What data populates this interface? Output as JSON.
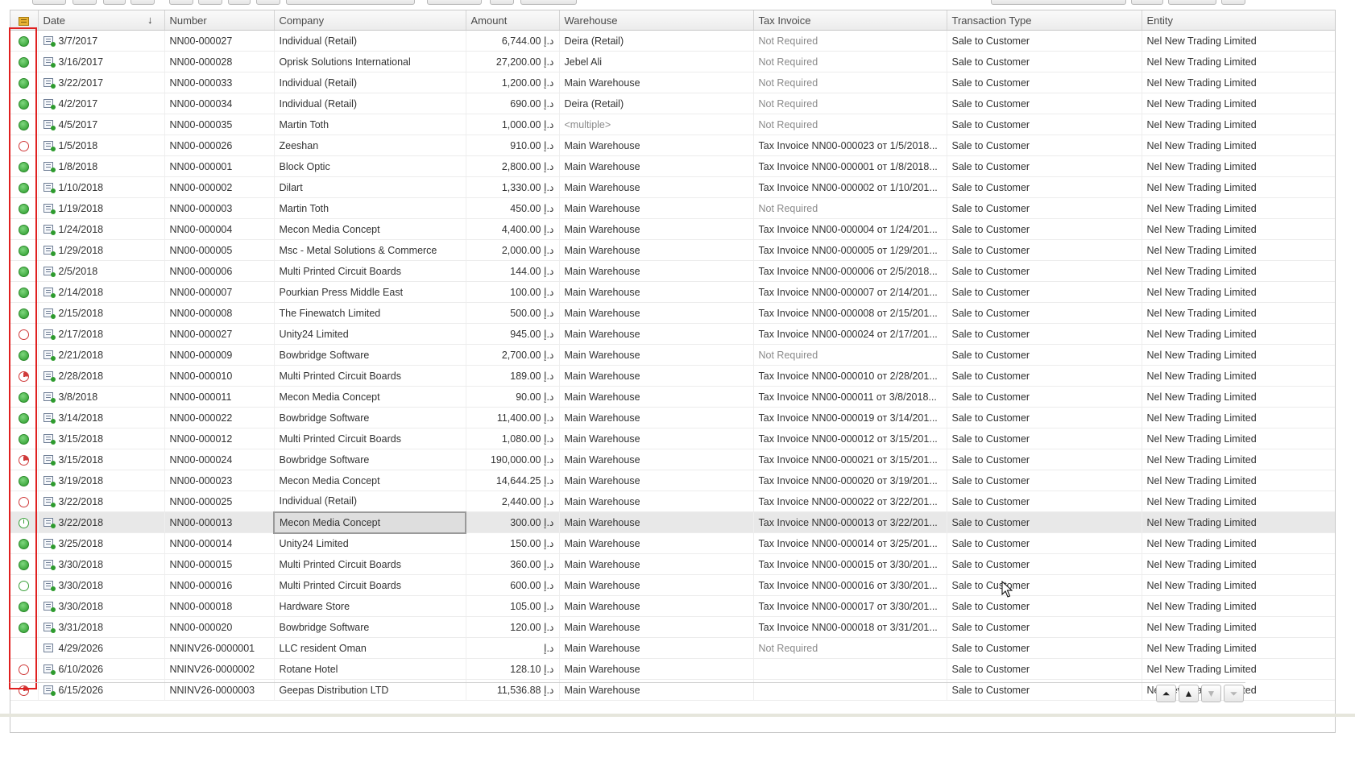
{
  "columns": {
    "date": "Date",
    "number": "Number",
    "company": "Company",
    "amount": "Amount",
    "warehouse": "Warehouse",
    "tax_invoice": "Tax Invoice",
    "transaction_type": "Transaction Type",
    "entity": "Entity"
  },
  "sort_indicator": "↓",
  "rows": [
    {
      "status": "green",
      "date": "3/7/2017",
      "number": "NN00-000027",
      "company": "Individual (Retail)",
      "amount": "6,744.00 د.إ",
      "warehouse": "Deira (Retail)",
      "tax": "Not Required",
      "tax_grey": true,
      "type": "Sale to Customer",
      "entity": "Nel New Trading Limited"
    },
    {
      "status": "green",
      "date": "3/16/2017",
      "number": "NN00-000028",
      "company": "Oprisk Solutions International",
      "amount": "27,200.00 د.إ",
      "warehouse": "Jebel Ali",
      "tax": "Not Required",
      "tax_grey": true,
      "type": "Sale to Customer",
      "entity": "Nel New Trading Limited"
    },
    {
      "status": "green",
      "date": "3/22/2017",
      "number": "NN00-000033",
      "company": "Individual (Retail)",
      "amount": "1,200.00 د.إ",
      "warehouse": "Main Warehouse",
      "tax": "Not Required",
      "tax_grey": true,
      "type": "Sale to Customer",
      "entity": "Nel New Trading Limited"
    },
    {
      "status": "green",
      "date": "4/2/2017",
      "number": "NN00-000034",
      "company": "Individual (Retail)",
      "amount": "690.00 د.إ",
      "warehouse": "Deira (Retail)",
      "tax": "Not Required",
      "tax_grey": true,
      "type": "Sale to Customer",
      "entity": "Nel New Trading Limited"
    },
    {
      "status": "green",
      "date": "4/5/2017",
      "number": "NN00-000035",
      "company": "Martin Toth",
      "amount": "1,000.00 د.إ",
      "warehouse": "<multiple>",
      "warehouse_grey": true,
      "tax": "Not Required",
      "tax_grey": true,
      "type": "Sale to Customer",
      "entity": "Nel New Trading Limited"
    },
    {
      "status": "empty-red",
      "date": "1/5/2018",
      "number": "NN00-000026",
      "company": "Zeeshan",
      "amount": "910.00 د.إ",
      "warehouse": "Main Warehouse",
      "tax": "Tax Invoice NN00-000023 от 1/5/2018...",
      "type": "Sale to Customer",
      "entity": "Nel New Trading Limited"
    },
    {
      "status": "green",
      "date": "1/8/2018",
      "number": "NN00-000001",
      "company": "Block Optic",
      "amount": "2,800.00 د.إ",
      "warehouse": "Main Warehouse",
      "tax": "Tax Invoice NN00-000001 от 1/8/2018...",
      "type": "Sale to Customer",
      "entity": "Nel New Trading Limited"
    },
    {
      "status": "green",
      "date": "1/10/2018",
      "number": "NN00-000002",
      "company": "Dilart",
      "amount": "1,330.00 د.إ",
      "warehouse": "Main Warehouse",
      "tax": "Tax Invoice NN00-000002 от 1/10/201...",
      "type": "Sale to Customer",
      "entity": "Nel New Trading Limited"
    },
    {
      "status": "green",
      "date": "1/19/2018",
      "number": "NN00-000003",
      "company": "Martin Toth",
      "amount": "450.00 د.إ",
      "warehouse": "Main Warehouse",
      "tax": "Not Required",
      "tax_grey": true,
      "type": "Sale to Customer",
      "entity": "Nel New Trading Limited"
    },
    {
      "status": "green",
      "date": "1/24/2018",
      "number": "NN00-000004",
      "company": "Mecon Media Concept",
      "amount": "4,400.00 د.إ",
      "warehouse": "Main Warehouse",
      "tax": "Tax Invoice NN00-000004 от 1/24/201...",
      "type": "Sale to Customer",
      "entity": "Nel New Trading Limited"
    },
    {
      "status": "green",
      "date": "1/29/2018",
      "number": "NN00-000005",
      "company": "Msc - Metal Solutions & Commerce",
      "amount": "2,000.00 د.إ",
      "warehouse": "Main Warehouse",
      "tax": "Tax Invoice NN00-000005 от 1/29/201...",
      "type": "Sale to Customer",
      "entity": "Nel New Trading Limited"
    },
    {
      "status": "green",
      "date": "2/5/2018",
      "number": "NN00-000006",
      "company": "Multi Printed Circuit Boards",
      "amount": "144.00 د.إ",
      "warehouse": "Main Warehouse",
      "tax": "Tax Invoice NN00-000006 от 2/5/2018...",
      "type": "Sale to Customer",
      "entity": "Nel New Trading Limited"
    },
    {
      "status": "green",
      "date": "2/14/2018",
      "number": "NN00-000007",
      "company": "Pourkian Press Middle East",
      "amount": "100.00 د.إ",
      "warehouse": "Main Warehouse",
      "tax": "Tax Invoice NN00-000007 от 2/14/201...",
      "type": "Sale to Customer",
      "entity": "Nel New Trading Limited"
    },
    {
      "status": "green",
      "date": "2/15/2018",
      "number": "NN00-000008",
      "company": "The Finewatch Limited",
      "amount": "500.00 د.إ",
      "warehouse": "Main Warehouse",
      "tax": "Tax Invoice NN00-000008 от 2/15/201...",
      "type": "Sale to Customer",
      "entity": "Nel New Trading Limited"
    },
    {
      "status": "empty-red",
      "date": "2/17/2018",
      "number": "NN00-000027",
      "company": "Unity24 Limited",
      "amount": "945.00 د.إ",
      "warehouse": "Main Warehouse",
      "tax": "Tax Invoice NN00-000024 от 2/17/201...",
      "type": "Sale to Customer",
      "entity": "Nel New Trading Limited"
    },
    {
      "status": "green",
      "date": "2/21/2018",
      "number": "NN00-000009",
      "company": "Bowbridge Software",
      "amount": "2,700.00 د.إ",
      "warehouse": "Main Warehouse",
      "tax": "Not Required",
      "tax_grey": true,
      "type": "Sale to Customer",
      "entity": "Nel New Trading Limited"
    },
    {
      "status": "partial-red",
      "date": "2/28/2018",
      "number": "NN00-000010",
      "company": "Multi Printed Circuit Boards",
      "amount": "189.00 د.إ",
      "warehouse": "Main Warehouse",
      "tax": "Tax Invoice NN00-000010 от 2/28/201...",
      "type": "Sale to Customer",
      "entity": "Nel New Trading Limited"
    },
    {
      "status": "green",
      "date": "3/8/2018",
      "number": "NN00-000011",
      "company": "Mecon Media Concept",
      "amount": "90.00 د.إ",
      "warehouse": "Main Warehouse",
      "tax": "Tax Invoice NN00-000011 от 3/8/2018...",
      "type": "Sale to Customer",
      "entity": "Nel New Trading Limited"
    },
    {
      "status": "green",
      "date": "3/14/2018",
      "number": "NN00-000022",
      "company": "Bowbridge Software",
      "amount": "11,400.00 د.إ",
      "warehouse": "Main Warehouse",
      "tax": "Tax Invoice NN00-000019 от 3/14/201...",
      "type": "Sale to Customer",
      "entity": "Nel New Trading Limited"
    },
    {
      "status": "green",
      "date": "3/15/2018",
      "number": "NN00-000012",
      "company": "Multi Printed Circuit Boards",
      "amount": "1,080.00 د.إ",
      "warehouse": "Main Warehouse",
      "tax": "Tax Invoice NN00-000012 от 3/15/201...",
      "type": "Sale to Customer",
      "entity": "Nel New Trading Limited"
    },
    {
      "status": "partial-red",
      "date": "3/15/2018",
      "number": "NN00-000024",
      "company": "Bowbridge Software",
      "amount": "190,000.00 د.إ",
      "warehouse": "Main Warehouse",
      "tax": "Tax Invoice NN00-000021 от 3/15/201...",
      "type": "Sale to Customer",
      "entity": "Nel New Trading Limited"
    },
    {
      "status": "green",
      "date": "3/19/2018",
      "number": "NN00-000023",
      "company": "Mecon Media Concept",
      "amount": "14,644.25 د.إ",
      "warehouse": "Main Warehouse",
      "tax": "Tax Invoice NN00-000020 от 3/19/201...",
      "type": "Sale to Customer",
      "entity": "Nel New Trading Limited"
    },
    {
      "status": "empty-red",
      "date": "3/22/2018",
      "number": "NN00-000025",
      "company": "Individual (Retail)",
      "amount": "2,440.00 د.إ",
      "warehouse": "Main Warehouse",
      "tax": "Tax Invoice NN00-000022 от 3/22/201...",
      "type": "Sale to Customer",
      "entity": "Nel New Trading Limited"
    },
    {
      "status": "partial-green",
      "selected": true,
      "date": "3/22/2018",
      "number": "NN00-000013",
      "company": "Mecon Media Concept",
      "amount": "300.00 د.إ",
      "warehouse": "Main Warehouse",
      "tax": "Tax Invoice NN00-000013 от 3/22/201...",
      "type": "Sale to Customer",
      "entity": "Nel New Trading Limited"
    },
    {
      "status": "green",
      "date": "3/25/2018",
      "number": "NN00-000014",
      "company": "Unity24 Limited",
      "amount": "150.00 د.إ",
      "warehouse": "Main Warehouse",
      "tax": "Tax Invoice NN00-000014 от 3/25/201...",
      "type": "Sale to Customer",
      "entity": "Nel New Trading Limited"
    },
    {
      "status": "green",
      "date": "3/30/2018",
      "number": "NN00-000015",
      "company": "Multi Printed Circuit Boards",
      "amount": "360.00 د.إ",
      "warehouse": "Main Warehouse",
      "tax": "Tax Invoice NN00-000015 от 3/30/201...",
      "type": "Sale to Customer",
      "entity": "Nel New Trading Limited"
    },
    {
      "status": "empty-green",
      "date": "3/30/2018",
      "number": "NN00-000016",
      "company": "Multi Printed Circuit Boards",
      "amount": "600.00 د.إ",
      "warehouse": "Main Warehouse",
      "tax": "Tax Invoice NN00-000016 от 3/30/201...",
      "type": "Sale to Customer",
      "entity": "Nel New Trading Limited"
    },
    {
      "status": "green",
      "date": "3/30/2018",
      "number": "NN00-000018",
      "company": "Hardware Store",
      "amount": "105.00 د.إ",
      "warehouse": "Main Warehouse",
      "tax": "Tax Invoice NN00-000017 от 3/30/201...",
      "type": "Sale to Customer",
      "entity": "Nel New Trading Limited"
    },
    {
      "status": "green",
      "date": "3/31/2018",
      "number": "NN00-000020",
      "company": "Bowbridge Software",
      "amount": "120.00 د.إ",
      "warehouse": "Main Warehouse",
      "tax": "Tax Invoice NN00-000018 от 3/31/201...",
      "type": "Sale to Customer",
      "entity": "Nel New Trading Limited"
    },
    {
      "status": "none",
      "draft": true,
      "date": "4/29/2026",
      "number": "NNINV26-0000001",
      "company": "LLC resident Oman",
      "amount": "د.إ",
      "warehouse": "Main Warehouse",
      "tax": "Not Required",
      "tax_grey": true,
      "type": "Sale to Customer",
      "entity": "Nel New Trading Limited"
    },
    {
      "status": "empty-red",
      "date": "6/10/2026",
      "number": "NNINV26-0000002",
      "company": "Rotane Hotel",
      "amount": "128.10 د.إ",
      "warehouse": "Main Warehouse",
      "tax": "",
      "type": "Sale to Customer",
      "entity": "Nel New Trading Limited"
    },
    {
      "status": "partial-red",
      "date": "6/15/2026",
      "number": "NNINV26-0000003",
      "company": "Geepas Distribution LTD",
      "amount": "11,536.88 د.إ",
      "warehouse": "Main Warehouse",
      "tax": "",
      "type": "Sale to Customer",
      "entity": "Nel New Trading Limited"
    }
  ],
  "pager": {
    "first": "⏶",
    "prev": "▲",
    "next": "▼",
    "last": "⏷"
  }
}
